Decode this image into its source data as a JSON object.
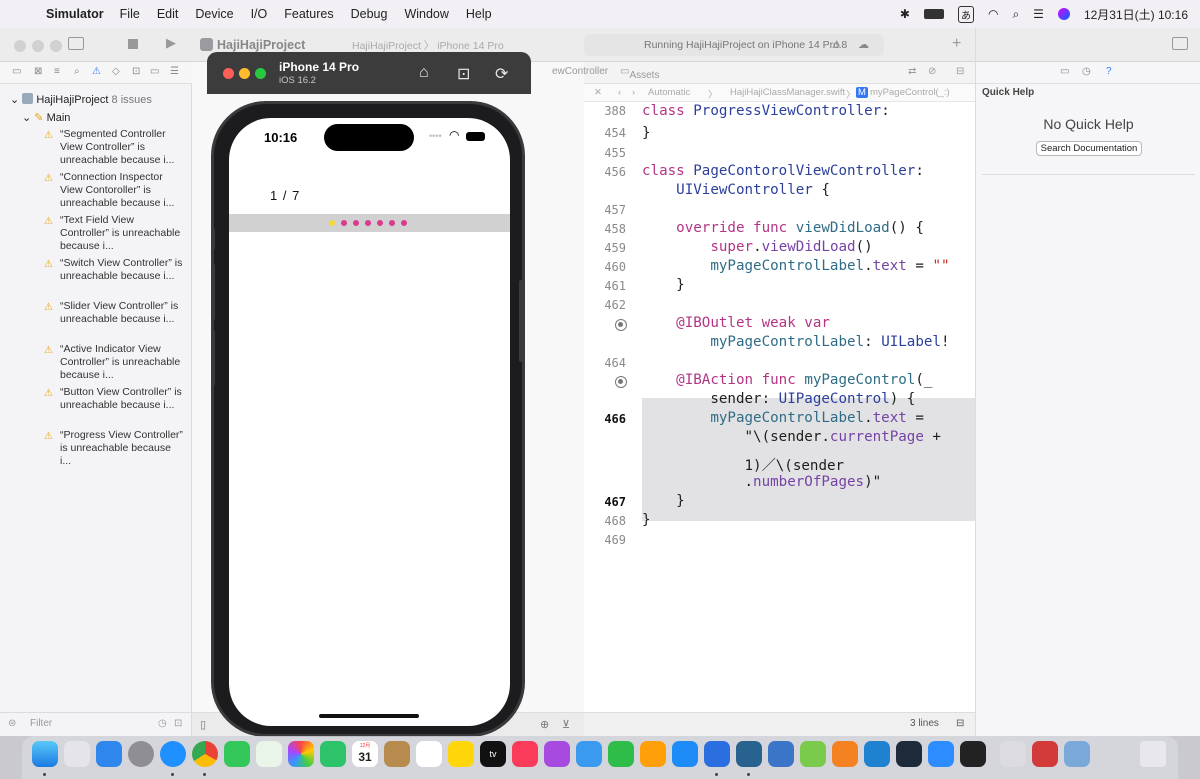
{
  "menubar": {
    "app": "Simulator",
    "items": [
      "File",
      "Edit",
      "Device",
      "I/O",
      "Features",
      "Debug",
      "Window",
      "Help"
    ],
    "input_method": "あ",
    "datetime": "12月31日(土) 10:16"
  },
  "toolbar": {
    "project_title": "HajiHajiProject",
    "scheme": "HajiHajiProject 〉 iPhone 14 Pro",
    "status": "Running HajiHajiProject on iPhone 14 Pro",
    "warning_count": "8"
  },
  "navigator": {
    "root_label": "HajiHajiProject",
    "root_sub": "8 issues",
    "group": "Main",
    "issues": [
      "“Segmented Controller View Controller” is unreachable because i...",
      "“Connection Inspector View Contoroller” is unreachable because i...",
      "“Text Field View Controller” is unreachable because i...",
      "“Switch View Controller” is unreachable because i...",
      "“Slider View Controller” is unreachable because i...",
      "“Active Indicator View Controller” is unreachable because i...",
      "“Button View Controller” is unreachable because i...",
      "“Progress View Controller” is unreachable because i..."
    ],
    "filter_placeholder": "Filter"
  },
  "editor": {
    "tab_left": "ewController",
    "tab_assets": "Assets",
    "jumpbar": [
      "Automatic",
      "HajiHajiClassManager.swift",
      "myPageControl(_:)"
    ],
    "line_count": "3 lines"
  },
  "inspector": {
    "title": "Quick Help",
    "no_help": "No Quick Help",
    "search_button": "Search Documentation"
  },
  "simulator": {
    "device": "iPhone 14 Pro",
    "os": "iOS 16.2",
    "time": "10:16",
    "page_label": "1 / 7",
    "page_count": 7,
    "current_page": 0
  }
}
